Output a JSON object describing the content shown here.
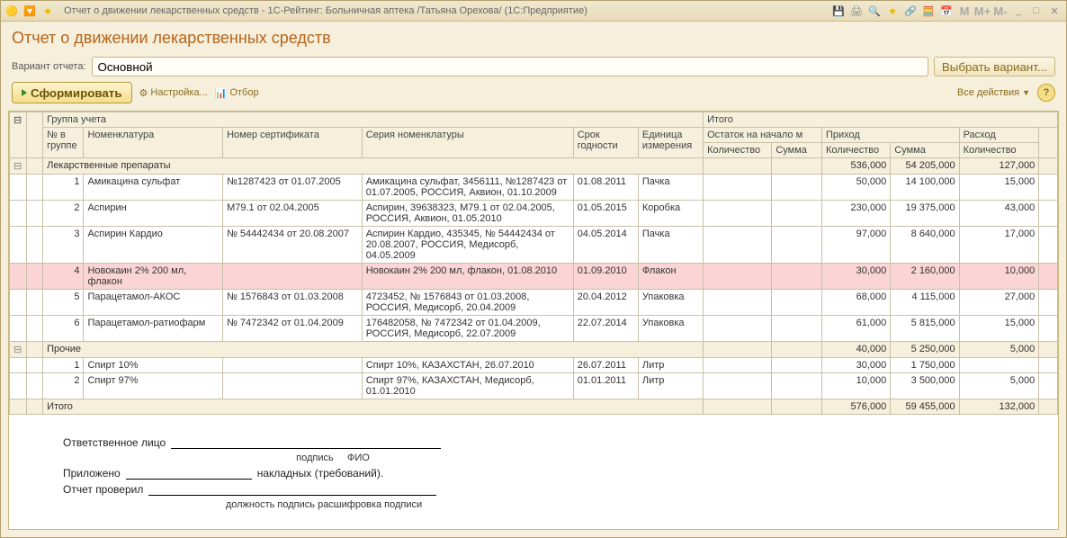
{
  "titlebar": {
    "title": "Отчет о движении лекарственных средств - 1С-Рейтинг: Больничная аптека /Татьяна Орехова/  (1С:Предприятие)"
  },
  "page_title": "Отчет о движении лекарственных средств",
  "variant": {
    "label": "Вариант отчета:",
    "value": "Основной",
    "choose_btn": "Выбрать вариант..."
  },
  "toolbar": {
    "form_btn": "Сформировать",
    "settings_btn": "Настройка...",
    "filter_btn": "Отбор",
    "actions_btn": "Все действия"
  },
  "headers": {
    "group": "Группа учета",
    "no": "№ в группе",
    "nomen": "Номенклатура",
    "cert": "Номер сертификата",
    "series": "Серия номенклатуры",
    "exp": "Срок годности",
    "unit": "Единица измерения",
    "itogo": "Итого",
    "start": "Остаток на начало м",
    "income": "Приход",
    "expense": "Расход",
    "qty": "Количество",
    "sum": "Сумма"
  },
  "groups": [
    {
      "name": "Лекарственные препараты",
      "totals": {
        "in_qty": "536,000",
        "in_sum": "54 205,000",
        "out_qty": "127,000"
      },
      "rows": [
        {
          "no": "1",
          "nomen": "Амикацина сульфат",
          "cert": "№1287423 от 01.07.2005",
          "series": "Амикацина сульфат, 3456111, №1287423 от 01.07.2005, РОССИЯ, Аквион, 01.10.2009",
          "exp": "01.08.2011",
          "unit": "Пачка",
          "in_qty": "50,000",
          "in_sum": "14 100,000",
          "out_qty": "15,000"
        },
        {
          "no": "2",
          "nomen": "Аспирин",
          "cert": "М79.1 от 02.04.2005",
          "series": "Аспирин, 39638323, М79.1 от 02.04.2005, РОССИЯ, Аквион, 01.05.2010",
          "exp": "01.05.2015",
          "unit": "Коробка",
          "in_qty": "230,000",
          "in_sum": "19 375,000",
          "out_qty": "43,000"
        },
        {
          "no": "3",
          "nomen": "Аспирин Кардио",
          "cert": "№ 54442434 от 20.08.2007",
          "series": "Аспирин Кардио, 435345, № 54442434 от 20.08.2007, РОССИЯ, Медисорб, 04.05.2009",
          "exp": "04.05.2014",
          "unit": "Пачка",
          "in_qty": "97,000",
          "in_sum": "8 640,000",
          "out_qty": "17,000"
        },
        {
          "no": "4",
          "nomen": "Новокаин 2% 200 мл, флакон",
          "cert": "",
          "series": "Новокаин 2% 200 мл, флакон, 01.08.2010",
          "exp": "01.09.2010",
          "unit": "Флакон",
          "in_qty": "30,000",
          "in_sum": "2 160,000",
          "out_qty": "10,000",
          "hl": true
        },
        {
          "no": "5",
          "nomen": "Парацетамол-АКОС",
          "cert": "№ 1576843 от 01.03.2008",
          "series": "4723452, № 1576843 от 01.03.2008, РОССИЯ, Медисорб, 20.04.2009",
          "exp": "20.04.2012",
          "unit": "Упаковка",
          "in_qty": "68,000",
          "in_sum": "4 115,000",
          "out_qty": "27,000"
        },
        {
          "no": "6",
          "nomen": "Парацетамол-ратиофарм",
          "cert": "№ 7472342 от 01.04.2009",
          "series": "176482058, № 7472342 от 01.04.2009, РОССИЯ, Медисорб, 22.07.2009",
          "exp": "22.07.2014",
          "unit": "Упаковка",
          "in_qty": "61,000",
          "in_sum": "5 815,000",
          "out_qty": "15,000"
        }
      ]
    },
    {
      "name": "Прочие",
      "totals": {
        "in_qty": "40,000",
        "in_sum": "5 250,000",
        "out_qty": "5,000"
      },
      "rows": [
        {
          "no": "1",
          "nomen": "Спирт 10%",
          "cert": "",
          "series": "Спирт 10%, КАЗАХСТАН, 26.07.2010",
          "exp": "26.07.2011",
          "unit": "Литр",
          "in_qty": "30,000",
          "in_sum": "1 750,000",
          "out_qty": ""
        },
        {
          "no": "2",
          "nomen": "Спирт 97%",
          "cert": "",
          "series": "Спирт 97%, КАЗАХСТАН, Медисорб, 01.01.2010",
          "exp": "01.01.2011",
          "unit": "Литр",
          "in_qty": "10,000",
          "in_sum": "3 500,000",
          "out_qty": "5,000"
        }
      ]
    }
  ],
  "grand_total": {
    "label": "Итого",
    "in_qty": "576,000",
    "in_sum": "59 455,000",
    "out_qty": "132,000"
  },
  "footer": {
    "resp": "Ответственное лицо",
    "sign": "подпись",
    "fio": "ФИО",
    "attached": "Приложено",
    "invoices": "накладных (требований).",
    "checked": "Отчет проверил",
    "caption": "должность подпись расшифровка подписи"
  }
}
